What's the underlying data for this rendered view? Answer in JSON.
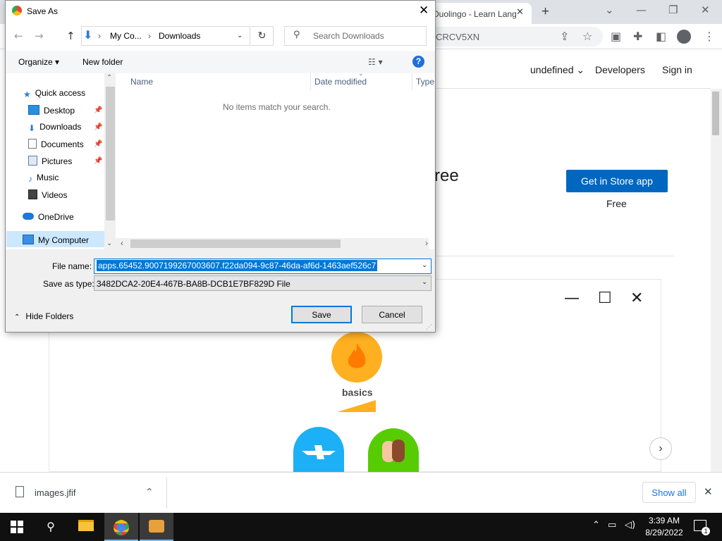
{
  "browser": {
    "tab_title": "Duolingo - Learn Lang",
    "tab_close": "✕",
    "new_tab": "+",
    "window_controls": [
      "⌄",
      "—",
      "❐",
      "✕"
    ],
    "address_partial": "CRCV5XN",
    "toolbar_icons": [
      "share-icon",
      "star-icon",
      "extension-icon",
      "sidepanel-icon",
      "profile-icon",
      "menu-icon"
    ]
  },
  "store_page": {
    "nav_links": [
      "undefined",
      "Developers",
      "Sign in"
    ],
    "hero_partial": "ree",
    "store_button": "Get in Store app",
    "price": "Free",
    "preview_controls": [
      "—",
      "☐",
      "✕"
    ],
    "skill_label": "basics"
  },
  "dialog": {
    "title": "Save As",
    "close": "✕",
    "breadcrumb": [
      "My Co...",
      "Downloads"
    ],
    "search_placeholder": "Search Downloads",
    "organize": "Organize ▾",
    "new_folder": "New folder",
    "help": "?",
    "nav_items": [
      {
        "label": "Quick access",
        "icon": "star-icon"
      },
      {
        "label": "Desktop",
        "icon": "desktop-icon",
        "pinned": true
      },
      {
        "label": "Downloads",
        "icon": "download-icon",
        "pinned": true
      },
      {
        "label": "Documents",
        "icon": "documents-icon",
        "pinned": true
      },
      {
        "label": "Pictures",
        "icon": "pictures-icon",
        "pinned": true
      },
      {
        "label": "Music",
        "icon": "music-icon"
      },
      {
        "label": "Videos",
        "icon": "videos-icon"
      },
      {
        "label": "OneDrive",
        "icon": "cloud-icon"
      },
      {
        "label": "My Computer",
        "icon": "computer-icon",
        "selected": true
      }
    ],
    "columns": [
      "Name",
      "Date modified",
      "Type"
    ],
    "empty_message": "No items match your search.",
    "file_name_label": "File name:",
    "file_name": "apps.65452.9007199267003607.f22da094-9c87-46da-af6d-1463aef526c7",
    "save_type_label": "Save as type:",
    "save_type": "3482DCA2-20E4-467B-BA8B-DCB1E7BF829D File",
    "hide_folders": "Hide Folders",
    "save_button": "Save",
    "cancel_button": "Cancel"
  },
  "downloads_bar": {
    "file": "images.jfif",
    "show_all": "Show all",
    "close": "✕"
  },
  "taskbar": {
    "time": "3:39 AM",
    "date": "8/29/2022",
    "notification_count": "1"
  },
  "colors": {
    "accent": "#0078d7",
    "store_button": "#0067c0",
    "duo_orange": "#ffb020",
    "duo_blue": "#1cb0f6",
    "duo_green": "#58cc02"
  }
}
